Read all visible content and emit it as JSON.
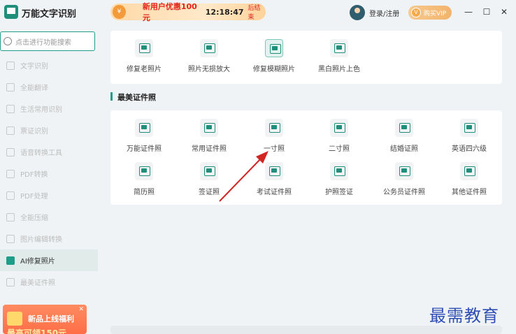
{
  "app": {
    "title": "万能文字识别"
  },
  "promo": {
    "text": "新用户优惠100元",
    "timer": "12:18:47",
    "end_label": "后结束"
  },
  "header": {
    "login_label": "登录/注册",
    "vip_label": "购买VIP"
  },
  "search": {
    "placeholder": "点击进行功能搜索"
  },
  "sidebar": {
    "items": [
      {
        "label": "文字识别",
        "icon": "text-recognition-icon"
      },
      {
        "label": "全能翻译",
        "icon": "translate-icon"
      },
      {
        "label": "生活常用识别",
        "icon": "scan-icon"
      },
      {
        "label": "票证识别",
        "icon": "ticket-icon"
      },
      {
        "label": "语音转换工具",
        "icon": "audio-icon"
      },
      {
        "label": "PDF转换",
        "icon": "pdf-icon"
      },
      {
        "label": "PDF处理",
        "icon": "pdf-tool-icon"
      },
      {
        "label": "全能压缩",
        "icon": "compress-icon"
      },
      {
        "label": "图片编辑转换",
        "icon": "image-edit-icon"
      },
      {
        "label": "AI修复照片",
        "icon": "ai-photo-icon",
        "active": true
      },
      {
        "label": "最美证件照",
        "icon": "id-photo-icon"
      }
    ]
  },
  "banner": {
    "text": "新品上线福利",
    "sub": "最高可领150元"
  },
  "photo_tools": [
    {
      "label": "修复老照片"
    },
    {
      "label": "照片无损放大"
    },
    {
      "label": "修复模糊照片",
      "selected": true
    },
    {
      "label": "黑白照片上色"
    }
  ],
  "id_section": {
    "title": "最美证件照"
  },
  "id_tools_row1": [
    {
      "label": "万能证件照"
    },
    {
      "label": "常用证件照"
    },
    {
      "label": "一寸照"
    },
    {
      "label": "二寸照"
    },
    {
      "label": "结婚证照"
    },
    {
      "label": "英语四六级"
    }
  ],
  "id_tools_row2": [
    {
      "label": "简历照"
    },
    {
      "label": "签证照"
    },
    {
      "label": "考试证件照"
    },
    {
      "label": "护照签证"
    },
    {
      "label": "公务员证件照"
    },
    {
      "label": "其他证件照"
    }
  ],
  "watermark": {
    "text": "最需教育"
  }
}
